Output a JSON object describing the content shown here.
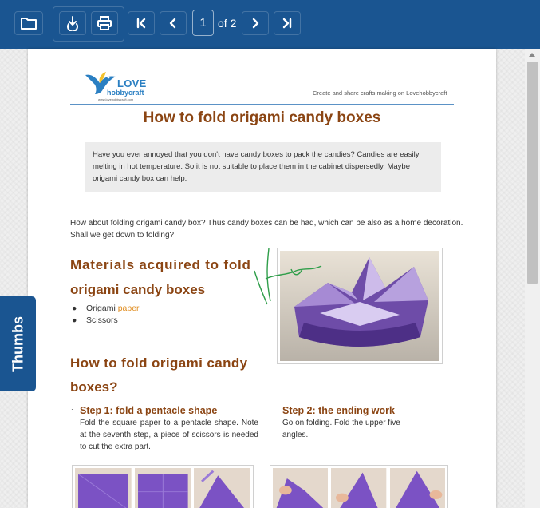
{
  "toolbar": {
    "page_current": "1",
    "page_of": "of 2"
  },
  "thumbs_tab": {
    "label": "Thumbs"
  },
  "doc": {
    "logo_love": "LOVE",
    "logo_hobby": "hobbycraft",
    "logo_url": "www.lovehobbycraft.com",
    "tagline": "Create and share crafts making on Lovehobbycraft",
    "title": "How to fold origami candy boxes",
    "intro": "Have you ever annoyed that you don't have candy boxes to pack the candies? Candies are easily melting in hot temperature. So it is not suitable to place them in the cabinet dispersedly. Maybe origami candy box can help.",
    "paragraph": "How about folding origami candy box? Thus candy boxes can be had, which can be also as a home decoration. Shall we get down to folding?",
    "materials_line1": "Materials acquired to fold",
    "materials_line2": "origami candy boxes",
    "material_1_prefix": "Origami ",
    "material_1_link": "paper",
    "material_2": "Scissors",
    "how_line1": "How to fold origami candy",
    "how_line2": "boxes?",
    "step1_title": "Step 1: fold a pentacle shape",
    "step1_text": "Fold the square paper to a pentacle shape. Note at the seventh step, a piece of scissors is needed to cut the extra part.",
    "step2_title": "Step 2: the ending work",
    "step2_text": "Go on folding. Fold the upper five angles.",
    "bullet": "●",
    "dot": "·"
  },
  "icons": {
    "open": "folder-icon",
    "download": "download-icon",
    "print": "print-icon",
    "first": "first-page-icon",
    "prev": "previous-page-icon",
    "next": "next-page-icon",
    "last": "last-page-icon"
  },
  "colors": {
    "toolbar": "#1a5591",
    "heading": "#8b4513",
    "link": "#e08b1c",
    "accent_rule": "#5b92c6"
  }
}
